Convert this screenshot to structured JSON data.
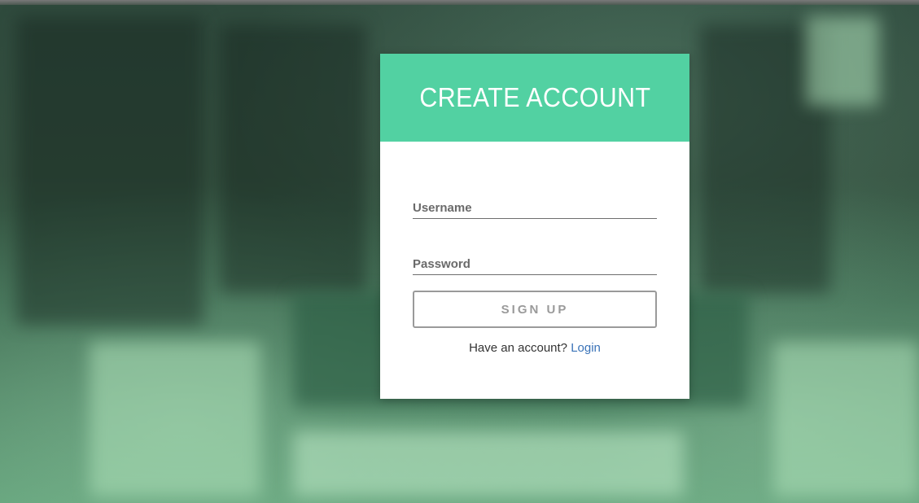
{
  "card": {
    "title": "CREATE ACCOUNT",
    "header_color": "#52d1a2"
  },
  "form": {
    "username_placeholder": "Username",
    "username_value": "",
    "password_placeholder": "Password",
    "password_value": "",
    "signup_label": "SIGN UP"
  },
  "footer": {
    "prompt": "Have an account?",
    "login_label": "Login",
    "login_color": "#3a73b8"
  }
}
